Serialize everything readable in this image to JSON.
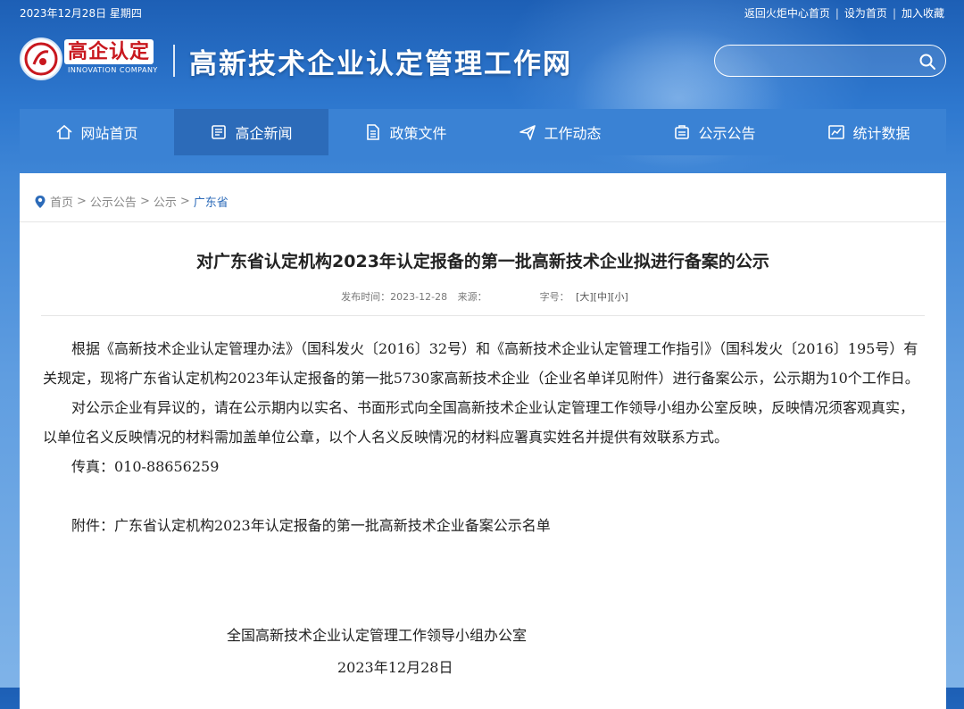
{
  "top": {
    "date": "2023年12月28日 星期四",
    "links": [
      "返回火炬中心首页",
      "设为首页",
      "加入收藏"
    ]
  },
  "logo": {
    "cn": "高企认定",
    "en": "INNOVATION COMPANY"
  },
  "site_title": "高新技术企业认定管理工作网",
  "search": {
    "placeholder": ""
  },
  "nav": [
    {
      "label": "网站首页",
      "icon": "home-icon"
    },
    {
      "label": "高企新闻",
      "icon": "news-icon"
    },
    {
      "label": "政策文件",
      "icon": "document-icon"
    },
    {
      "label": "工作动态",
      "icon": "send-icon"
    },
    {
      "label": "公示公告",
      "icon": "notice-icon"
    },
    {
      "label": "统计数据",
      "icon": "chart-icon"
    }
  ],
  "breadcrumb": [
    "首页",
    "公示公告",
    "公示",
    "广东省"
  ],
  "breadcrumb_sep": ">",
  "article": {
    "title": "对广东省认定机构2023年认定报备的第一批高新技术企业拟进行备案的公示",
    "publish_label": "发布时间：",
    "publish_date": "2023-12-28",
    "source_label": "来源：",
    "fontsize_label": "字号：",
    "size_large": "[大]",
    "size_medium": "[中]",
    "size_small": "[小]",
    "paragraphs": [
      "根据《高新技术企业认定管理办法》（国科发火〔2016〕32号）和《高新技术企业认定管理工作指引》（国科发火〔2016〕195号）有关规定，现将广东省认定机构2023年认定报备的第一批5730家高新技术企业（企业名单详见附件）进行备案公示，公示期为10个工作日。",
      "对公示企业有异议的，请在公示期内以实名、书面形式向全国高新技术企业认定管理工作领导小组办公室反映，反映情况须客观真实，以单位名义反映情况的材料需加盖单位公章，以个人名义反映情况的材料应署真实姓名并提供有效联系方式。",
      "传真：010-88656259"
    ],
    "attachment": "附件：广东省认定机构2023年认定报备的第一批高新技术企业备案公示名单",
    "signature": "全国高新技术企业认定管理工作领导小组办公室",
    "sign_date": "2023年12月28日"
  }
}
